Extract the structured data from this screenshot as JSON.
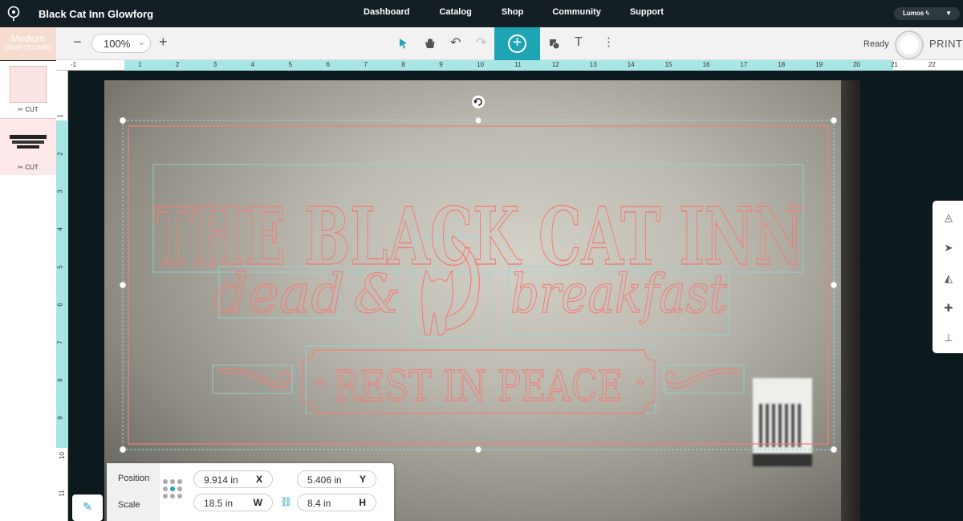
{
  "header": {
    "app_title": "Black Cat Inn  Glowforg",
    "nav": [
      "Dashboard",
      "Catalog",
      "Shop",
      "Community",
      "Support"
    ],
    "user_menu": "Lumos",
    "user_menu_icon": "lightning-icon"
  },
  "toolbar": {
    "material_name": "Medium",
    "material_type": "DRAFTBOARD",
    "zoom_value": "100%",
    "status": "Ready",
    "print_label": "PRINT",
    "icons": [
      "minus-icon",
      "plus-icon",
      "pointer-icon",
      "hand-icon",
      "undo-icon",
      "redo-icon",
      "add-circle-icon",
      "shapes-icon",
      "text-icon",
      "more-icon"
    ]
  },
  "left_panel": {
    "items": [
      {
        "label": "CUT",
        "icon": "cut-icon"
      },
      {
        "label": "CUT",
        "icon": "cut-icon",
        "thumb_text": "THE BLACK CAT INN"
      }
    ]
  },
  "rulers": {
    "horizontal": [
      "-1",
      "1",
      "2",
      "3",
      "4",
      "5",
      "6",
      "7",
      "8",
      "9",
      "10",
      "11",
      "12",
      "13",
      "14",
      "15",
      "16",
      "17",
      "18",
      "19",
      "20",
      "21",
      "22"
    ],
    "vertical": [
      "1",
      "2",
      "3",
      "4",
      "5",
      "6",
      "7",
      "8",
      "9",
      "10",
      "11"
    ]
  },
  "design": {
    "line1": "THE BLACK CAT INN",
    "line2_left": "dead",
    "line2_amp": "&",
    "line2_right": "breakfast",
    "line3": "REST IN PEACE",
    "stroke_color": "#f07f7a",
    "selection_color": "#8fd8d8"
  },
  "side_tools": [
    "trace-icon",
    "send-icon",
    "align-icon",
    "puzzle-icon",
    "stamp-icon"
  ],
  "position_panel": {
    "position_label": "Position",
    "scale_label": "Scale",
    "x_value": "9.914 in",
    "x_axis": "X",
    "y_value": "5.406 in",
    "y_axis": "Y",
    "w_value": "18.5 in",
    "w_axis": "W",
    "h_value": "8.4 in",
    "h_axis": "H",
    "lock_icon": "link-icon"
  },
  "colors": {
    "accent": "#1fa4b4",
    "ruler_active": "#a8e6e6",
    "material_bg": "#f5dcce"
  }
}
